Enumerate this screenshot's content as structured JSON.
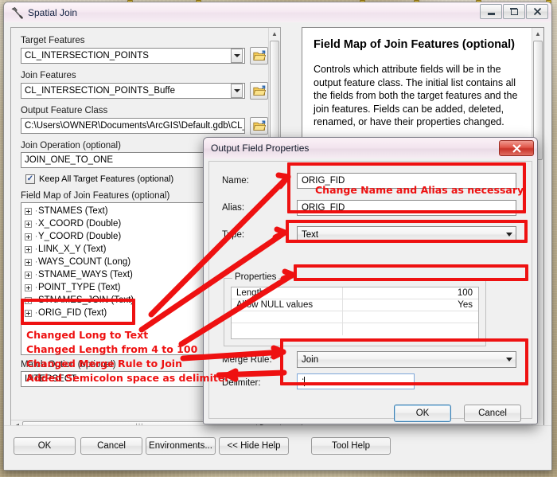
{
  "window": {
    "title": "Spatial Join",
    "icon": "hammer-icon",
    "minimize_label": "Minimize",
    "restore_label": "Restore",
    "close_label": "Close"
  },
  "form": {
    "target_features": {
      "label": "Target Features",
      "value": "CL_INTERSECTION_POINTS"
    },
    "join_features": {
      "label": "Join Features",
      "value": "CL_INTERSECTION_POINTS_Buffe"
    },
    "output_feature_class": {
      "label": "Output Feature Class",
      "value": "C:\\Users\\OWNER\\Documents\\ArcGIS\\Default.gdb\\CL_IN"
    },
    "join_operation": {
      "label": "Join Operation (optional)",
      "value": "JOIN_ONE_TO_ONE"
    },
    "keep_all_target": {
      "label": "Keep All Target Features (optional)",
      "checked": true
    },
    "field_map": {
      "label": "Field Map of Join Features (optional)"
    },
    "match_option": {
      "label": "Match Option (optional)",
      "value": "INTERSECT"
    },
    "browse_button_label": "Browse"
  },
  "field_list": [
    {
      "name": "STNAMES (Text)"
    },
    {
      "name": "X_COORD (Double)"
    },
    {
      "name": "Y_COORD (Double)"
    },
    {
      "name": "LINK_X_Y (Text)"
    },
    {
      "name": "WAYS_COUNT (Long)"
    },
    {
      "name": "STNAME_WAYS (Text)"
    },
    {
      "name": "POINT_TYPE (Text)"
    },
    {
      "name": "STNAMES_JOIN (Text)"
    },
    {
      "name": "ORIG_FID (Text)"
    }
  ],
  "help": {
    "title": "Field Map of Join Features (optional)",
    "body": "Controls which attribute fields will be in the output feature class. The initial list contains all the fields from both the target features and the join features. Fields can be added, deleted, renamed, or have their properties changed."
  },
  "buttons": {
    "ok": "OK",
    "cancel": "Cancel",
    "environments": "Environments...",
    "hide_help": "<< Hide Help",
    "tool_help": "Tool Help"
  },
  "dialog": {
    "title": "Output Field Properties",
    "close_glyph": "✕",
    "name": {
      "label": "Name:",
      "value": "ORIG_FID"
    },
    "alias": {
      "label": "Alias:",
      "value": "ORIG_FID"
    },
    "type": {
      "label": "Type:",
      "value": "Text"
    },
    "properties": {
      "legend": "Properties",
      "rows": [
        {
          "key": "Length",
          "value": "100"
        },
        {
          "key": "Allow NULL values",
          "value": "Yes"
        },
        {
          "key": "",
          "value": ""
        },
        {
          "key": "",
          "value": ""
        }
      ]
    },
    "merge_rule": {
      "label": "Merge Rule:",
      "value": "Join"
    },
    "delimiter": {
      "label": "Delimiter:",
      "value": "; "
    },
    "ok": "OK",
    "cancel": "Cancel"
  },
  "annotations": {
    "color": "#ee1111",
    "name_alias_note": "Change Name and Alias as necessary",
    "note_1": "Changed Long to Text",
    "note_2": "Changed Length from 4 to 100",
    "note_3": "Changed Merge Rule to Join",
    "note_4": "Added Semicolon space as delimiter"
  }
}
